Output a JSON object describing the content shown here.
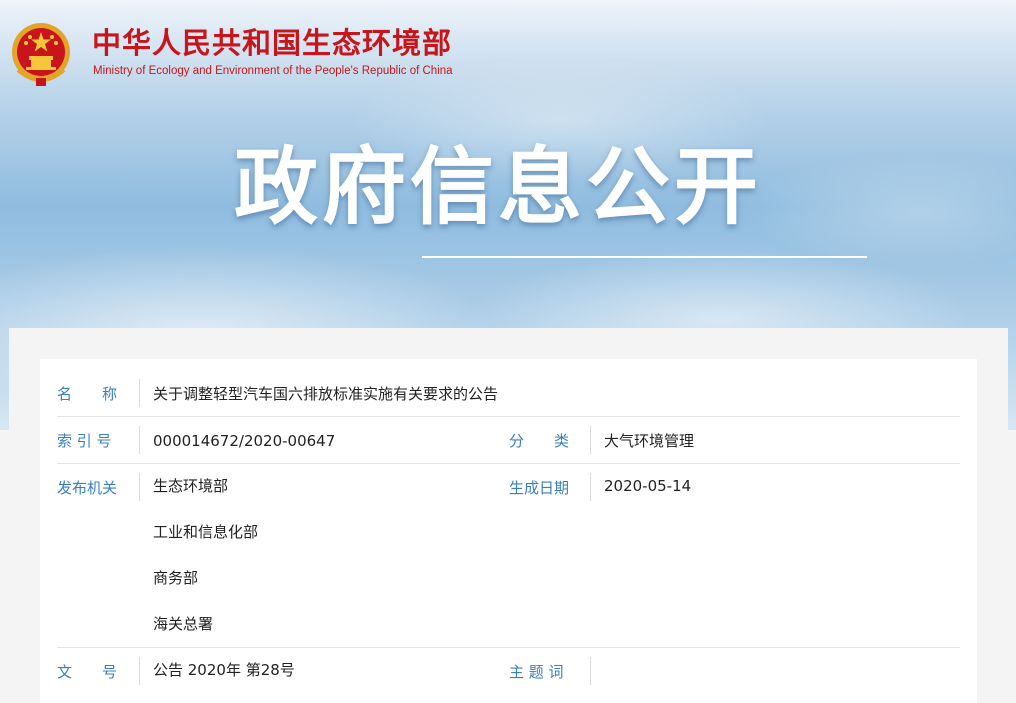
{
  "header": {
    "ministry_cn": "中华人民共和国生态环境部",
    "ministry_en": "Ministry of Ecology and Environment of the People's Republic of China",
    "banner_title": "政府信息公开"
  },
  "colors": {
    "brand_red": "#c8151b",
    "label_blue": "#3a7ec1",
    "value_text": "#222222"
  },
  "info": {
    "name_label": "名　　称",
    "name_value": "关于调整轻型汽车国六排放标准实施有关要求的公告",
    "index_label": "索 引 号",
    "index_value": "000014672/2020-00647",
    "category_label": "分　　类",
    "category_value": "大气环境管理",
    "issuer_label": "发布机关",
    "issuers": [
      "生态环境部",
      "工业和信息化部",
      "商务部",
      "海关总署"
    ],
    "date_label": "生成日期",
    "date_value": "2020-05-14",
    "docno_label": "文　　号",
    "docno_value": "公告 2020年 第28号",
    "subject_label": "主 题 词",
    "subject_value": ""
  }
}
